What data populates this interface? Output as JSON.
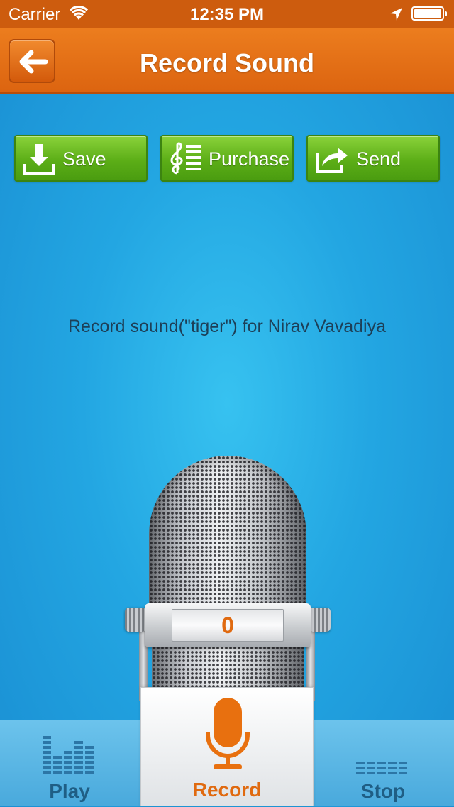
{
  "status_bar": {
    "carrier": "Carrier",
    "time": "12:35 PM",
    "wifi_icon": "wifi-icon",
    "location_icon": "location-arrow-icon",
    "battery_icon": "battery-icon"
  },
  "nav": {
    "title": "Record Sound",
    "back_icon": "arrow-left-icon"
  },
  "actions": {
    "save": {
      "label": "Save",
      "icon": "download-icon"
    },
    "purchase": {
      "label": "Purchase",
      "icon": "music-score-icon"
    },
    "send": {
      "label": "Send",
      "icon": "share-icon"
    }
  },
  "message": "Record sound(\"tiger\") for Nirav Vavadiya",
  "microphone": {
    "counter": "0"
  },
  "tabs": {
    "play": {
      "label": "Play",
      "icon": "equalizer-icon"
    },
    "record": {
      "label": "Record",
      "icon": "microphone-icon"
    },
    "stop": {
      "label": "Stop",
      "icon": "stop-bars-icon"
    }
  },
  "colors": {
    "accent": "#e06a10",
    "navbar": "#dc6410",
    "button_green": "#5cae17",
    "background": "#23a6e2"
  }
}
